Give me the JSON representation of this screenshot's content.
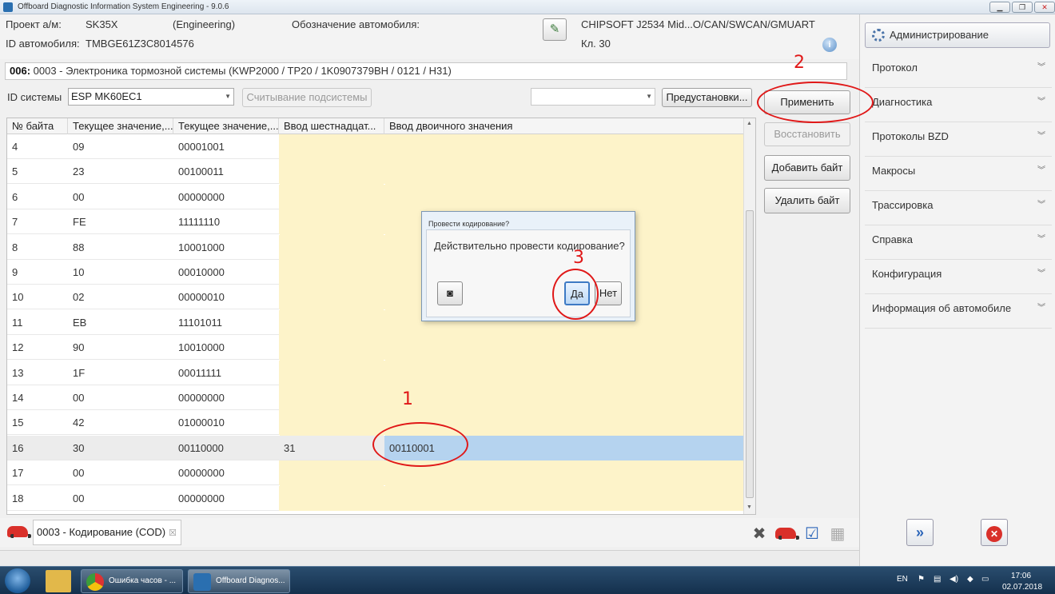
{
  "window": {
    "title": "Offboard Diagnostic Information System Engineering - 9.0.6"
  },
  "header": {
    "project_label": "Проект а/м:",
    "project_value": "SK35X",
    "mode": "(Engineering)",
    "vehicle_designation_label": "Обозначение автомобиля:",
    "vehicle_id_label": "ID автомобиля:",
    "vehicle_id_value": "TMBGE61Z3C8014576",
    "interface": "CHIPSOFT J2534 Mid...O/CAN/SWCAN/GMUART",
    "terminal": "Кл. 30"
  },
  "system_path": {
    "prefix": "006:",
    "text": " 0003 - Электроника тормозной системы  (KWP2000 / TP20 / 1K0907379BH / 0121 / H31)"
  },
  "controls": {
    "system_id_label": "ID системы",
    "system_id_value": "ESP MK60EC1",
    "read_subsystem": "Считывание подсистемы",
    "presets": "Предустановки...",
    "apply": "Применить",
    "restore": "Восстановить",
    "add_byte": "Добавить байт",
    "delete_byte": "Удалить байт"
  },
  "grid": {
    "columns": [
      "№ байта",
      "Текущее значение,...",
      "Текущее значение,...",
      "Ввод шестнадцат...",
      "Ввод двоичного значения"
    ],
    "rows": [
      {
        "n": "4",
        "hex": "09",
        "bin": "00001001",
        "in_hex": "",
        "in_bin": ""
      },
      {
        "n": "5",
        "hex": "23",
        "bin": "00100011",
        "in_hex": "",
        "in_bin": ""
      },
      {
        "n": "6",
        "hex": "00",
        "bin": "00000000",
        "in_hex": "",
        "in_bin": ""
      },
      {
        "n": "7",
        "hex": "FE",
        "bin": "11111110",
        "in_hex": "",
        "in_bin": ""
      },
      {
        "n": "8",
        "hex": "88",
        "bin": "10001000",
        "in_hex": "",
        "in_bin": ""
      },
      {
        "n": "9",
        "hex": "10",
        "bin": "00010000",
        "in_hex": "",
        "in_bin": ""
      },
      {
        "n": "10",
        "hex": "02",
        "bin": "00000010",
        "in_hex": "",
        "in_bin": ""
      },
      {
        "n": "11",
        "hex": "EB",
        "bin": "11101011",
        "in_hex": "",
        "in_bin": ""
      },
      {
        "n": "12",
        "hex": "90",
        "bin": "10010000",
        "in_hex": "",
        "in_bin": ""
      },
      {
        "n": "13",
        "hex": "1F",
        "bin": "00011111",
        "in_hex": "",
        "in_bin": ""
      },
      {
        "n": "14",
        "hex": "00",
        "bin": "00000000",
        "in_hex": "",
        "in_bin": ""
      },
      {
        "n": "15",
        "hex": "42",
        "bin": "01000010",
        "in_hex": "",
        "in_bin": ""
      },
      {
        "n": "16",
        "hex": "30",
        "bin": "00110000",
        "in_hex": "31",
        "in_bin": "00110001"
      },
      {
        "n": "17",
        "hex": "00",
        "bin": "00000000",
        "in_hex": "",
        "in_bin": ""
      },
      {
        "n": "18",
        "hex": "00",
        "bin": "00000000",
        "in_hex": "",
        "in_bin": ""
      }
    ]
  },
  "sidebar": {
    "admin": "Администрирование",
    "items": [
      "Протокол",
      "Диагностика",
      "Протоколы BZD",
      "Макросы",
      "Трассировка",
      "Справка",
      "Конфигурация",
      "Информация об автомобиле"
    ]
  },
  "tab": {
    "label": "0003 - Кодирование (COD)",
    "close": "☒"
  },
  "dialog": {
    "title": "Провести кодирование?",
    "message": "Действительно провести кодирование?",
    "yes": "Да",
    "no": "Нет"
  },
  "annotations": [
    "1",
    "2",
    "3"
  ],
  "taskbar": {
    "items": [
      "Ошибка часов - ...",
      "Offboard Diagnos..."
    ],
    "lang": "EN",
    "time": "17:06",
    "date": "02.07.2018"
  },
  "colors": {
    "highlight_yellow": "#fdf3c9",
    "selected_blue": "#b5d3ef",
    "annotation_red": "#e01818"
  }
}
